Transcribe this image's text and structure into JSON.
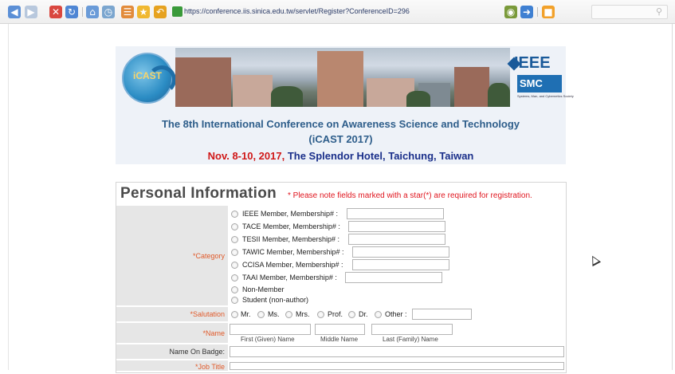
{
  "browser": {
    "url": "https://conference.iis.sinica.edu.tw/servlet/Register?ConferenceID=296"
  },
  "banner": {
    "logo_text": "iCAST",
    "ieee_text": "IEEE",
    "smc_text": "SMC",
    "smc_subtext": "Systems, Man, and Cybernetics Society",
    "title_line1": "The 8th International Conference on Awareness Science and Technology",
    "title_line2": "(iCAST 2017)",
    "date_text": "Nov. 8-10, 2017,",
    "venue_text": " The Splendor Hotel, Taichung, Taiwan"
  },
  "form": {
    "heading": "Personal Information",
    "note": "* Please note fields marked with a star(*) are required for registration.",
    "category_label": "*Category",
    "category_options": [
      "IEEE Member, Membership# :",
      "TACE Member, Membership# :",
      "TESII Member, Membership# :",
      "TAWIC Member, Membership# :",
      "CCISA Member, Membership# :",
      "TAAI Member, Membership# :",
      "Non-Member",
      "Student (non-author)"
    ],
    "salutation_label": "*Salutation",
    "salutation_options": [
      "Mr.",
      "Ms.",
      "Mrs.",
      "Prof.",
      "Dr.",
      "Other :"
    ],
    "name_label": "*Name",
    "first_name_caption": "First (Given) Name",
    "middle_name_caption": "Middle Name",
    "last_name_caption": "Last (Family) Name",
    "badge_label": "Name On Badge:",
    "job_label": "*Job Title"
  }
}
